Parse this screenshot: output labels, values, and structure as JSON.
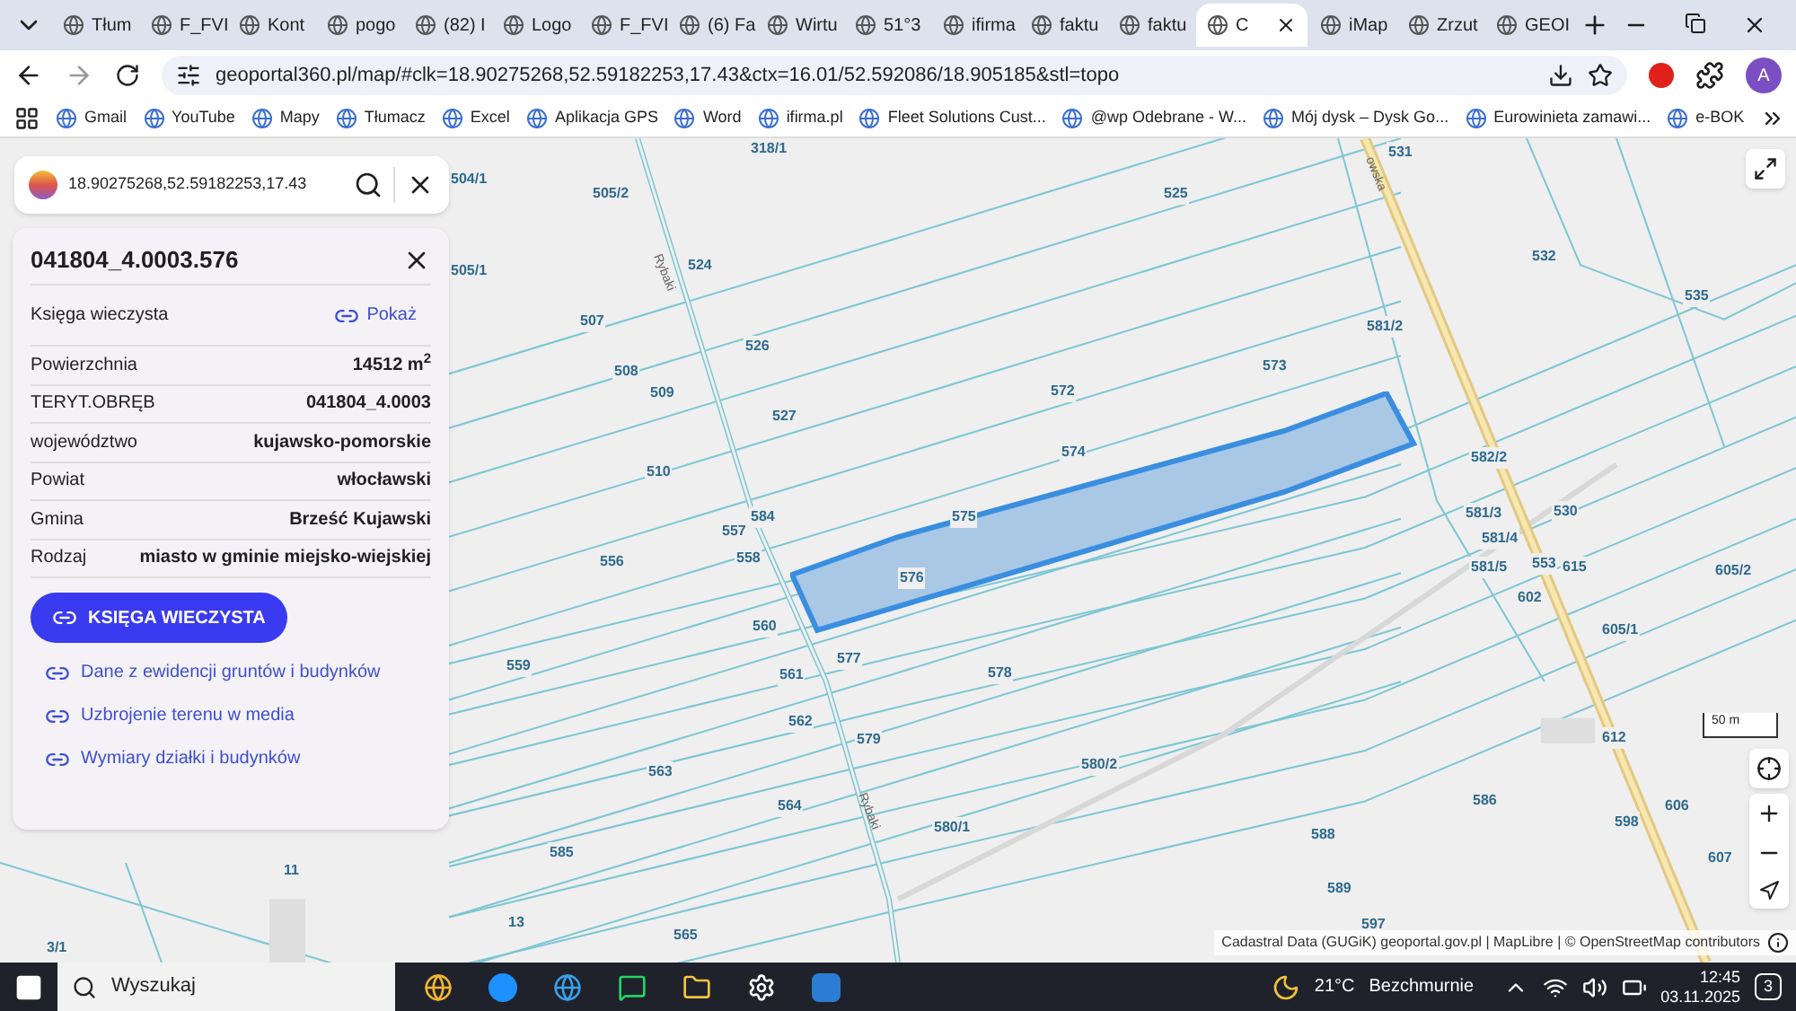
{
  "browser": {
    "tabs": [
      {
        "label": "Tłum",
        "selected": false
      },
      {
        "label": "F_FVI",
        "selected": false
      },
      {
        "label": "Kont",
        "selected": false
      },
      {
        "label": "pogo",
        "selected": false
      },
      {
        "label": "(82) I",
        "selected": false
      },
      {
        "label": "Logo",
        "selected": false
      },
      {
        "label": "F_FVI",
        "selected": false
      },
      {
        "label": "(6) Fa",
        "selected": false
      },
      {
        "label": "Wirtu",
        "selected": false
      },
      {
        "label": "51°3",
        "selected": false
      },
      {
        "label": "ifirma",
        "selected": false
      },
      {
        "label": "faktu",
        "selected": false
      },
      {
        "label": "faktu",
        "selected": false
      },
      {
        "label": "C",
        "selected": true
      },
      {
        "label": "iMap",
        "selected": false
      },
      {
        "label": "Zrzut",
        "selected": false
      },
      {
        "label": "GEOI",
        "selected": false
      }
    ],
    "url": "geoportal360.pl/map/#clk=18.90275268,52.59182253,17.43&ctx=16.01/52.592086/18.905185&stl=topo",
    "profile_initial": "A",
    "bookmarks": [
      "Gmail",
      "YouTube",
      "Mapy",
      "Tłumacz",
      "Excel",
      "Aplikacja GPS",
      "Word",
      "ifirma.pl",
      "Fleet Solutions Cust...",
      "@wp Odebrane - W...",
      "Mój dysk – Dysk Go...",
      "Eurowinieta zamawi...",
      "e-BOK"
    ]
  },
  "search": {
    "value": "18.90275268,52.59182253,17.43"
  },
  "parcel": {
    "title": "041804_4.0003.576",
    "register_label": "Księga wieczysta",
    "register_link": "Pokaż",
    "rows": [
      {
        "label": "Powierzchnia",
        "value": "14512 m$^{2}$"
      },
      {
        "label": "TERYT.OBRĘB",
        "value": "041804_4.0003"
      },
      {
        "label": "województwo",
        "value": "kujawsko-pomorskie"
      },
      {
        "label": "Powiat",
        "value": "włocławski"
      },
      {
        "label": "Gmina",
        "value": "Brześć Kujawski"
      },
      {
        "label": "Rodzaj",
        "value": "miasto w gminie miejsko-wiejskiej"
      }
    ],
    "button": "KSIĘGA WIECZYSTA",
    "links": [
      "Dane z ewidencji gruntów i budynków",
      "Uzbrojenie terenu w media",
      "Wymiary działki i budynków"
    ]
  },
  "map": {
    "parcel_labels": [
      "318/1",
      "531",
      "504/1",
      "505/2",
      "525",
      "505/1",
      "524",
      "532",
      "535",
      "507",
      "526",
      "581/2",
      "573",
      "508",
      "509",
      "572",
      "527",
      "574",
      "582/2",
      "510",
      "584",
      "575",
      "581/3",
      "530",
      "557",
      "581/4",
      "556",
      "558",
      "576",
      "581/5",
      "553",
      "615",
      "605/2",
      "602",
      "560",
      "605/1",
      "559",
      "577",
      "561",
      "578",
      "562",
      "579",
      "612",
      "580/2",
      "563",
      "586",
      "564",
      "606",
      "598",
      "580/1",
      "588",
      "11",
      "585",
      "607",
      "589",
      "597",
      "13",
      "565",
      "3/1"
    ],
    "street_labels": [
      "Rybaki",
      "Rybaki",
      "owska"
    ],
    "scale": "50 m",
    "attribution": "Cadastral Data (GUGiK) geoportal.gov.pl | MapLibre | © OpenStreetMap contributors"
  },
  "taskbar": {
    "search_placeholder": "Wyszukaj",
    "temperature": "21°C",
    "weather": "Bezchmurnie",
    "time": "12:45",
    "date": "03.11.2025",
    "notifications": "3"
  }
}
